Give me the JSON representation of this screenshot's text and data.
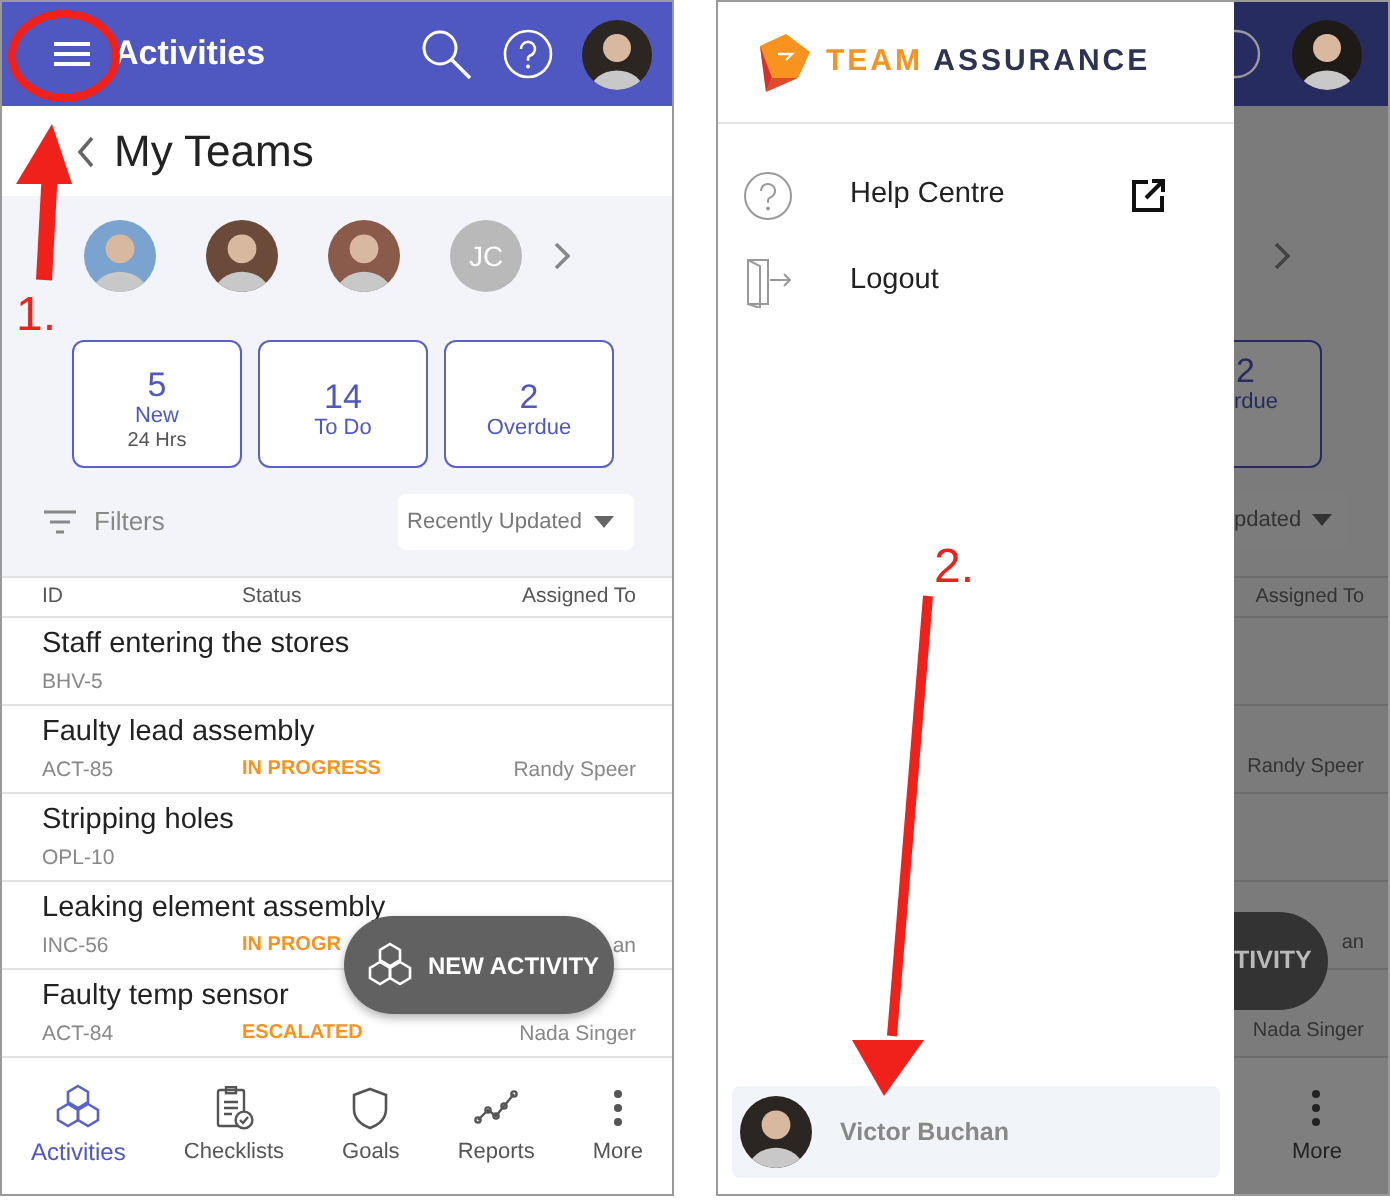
{
  "app": {
    "title": "Activities",
    "page_title": "My Teams",
    "team_members": [
      {
        "kind": "photo"
      },
      {
        "kind": "photo"
      },
      {
        "kind": "photo"
      },
      {
        "kind": "initials",
        "initials": "JC"
      }
    ],
    "stats": [
      {
        "value": "5",
        "label": "New",
        "sub": "24 Hrs"
      },
      {
        "value": "14",
        "label": "To Do"
      },
      {
        "value": "2",
        "label": "Overdue"
      }
    ],
    "filters_label": "Filters",
    "sort": "Recently Updated",
    "columns": [
      "ID",
      "Status",
      "Assigned To"
    ],
    "activities": [
      {
        "title": "Staff entering the stores",
        "id": "BHV-5"
      },
      {
        "title": "Faulty lead assembly",
        "id": "ACT-85",
        "status": "IN PROGRESS",
        "assignee": "Randy Speer"
      },
      {
        "title": "Stripping holes",
        "id": "OPL-10"
      },
      {
        "title": "Leaking element assembly",
        "id": "INC-56",
        "status": "IN PROGR",
        "assignee": "an"
      },
      {
        "title": "Faulty temp sensor",
        "id": "ACT-84",
        "status": "ESCALATED",
        "assignee": "Nada Singer"
      }
    ],
    "fab": "NEW ACTIVITY",
    "nav": [
      {
        "label": "Activities",
        "kind": "hexagons",
        "selected": true
      },
      {
        "label": "Checklists",
        "kind": "checklist",
        "selected": false
      },
      {
        "label": "Goals",
        "kind": "shield",
        "selected": false
      },
      {
        "label": "Reports",
        "kind": "chart",
        "selected": false
      },
      {
        "label": "More",
        "kind": "dots",
        "selected": false
      }
    ]
  },
  "drawer": {
    "brand_first": "TEAM",
    "brand_second": "ASSURANCE",
    "items": [
      {
        "label": "Help Centre",
        "kind": "help",
        "external": true
      },
      {
        "label": "Logout",
        "kind": "logout",
        "external": false
      }
    ],
    "user": "Victor Buchan"
  },
  "behind_drawer": {
    "stat_value": "2",
    "stat_label": "rdue",
    "sort": "pdated",
    "column": "Assigned To",
    "rows": [
      {},
      {
        "assignee": "Randy Speer"
      },
      {},
      {
        "assignee": "an"
      },
      {
        "assignee": "Nada Singer"
      }
    ],
    "fab": "TIVITY",
    "nav_label": "More"
  },
  "annotations": [
    {
      "label": "1."
    },
    {
      "label": "2."
    }
  ]
}
